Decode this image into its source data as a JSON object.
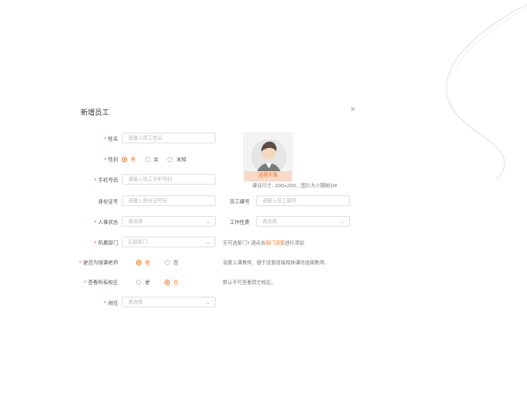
{
  "dialog": {
    "title": "新增员工",
    "close": "×"
  },
  "form": {
    "name": {
      "label": "姓名",
      "placeholder": "请输入员工姓名"
    },
    "gender": {
      "label": "性别",
      "options": [
        "男",
        "女",
        "未知"
      ],
      "selected": "男"
    },
    "phone": {
      "label": "手机号码",
      "placeholder": "请输入员工手机号码"
    },
    "id_card": {
      "label": "身份证号",
      "placeholder": "请输入身份证号码"
    },
    "employee_no": {
      "label": "员工编号",
      "placeholder": "请输入员工编号"
    },
    "hr_status": {
      "label": "人事状态",
      "value": "请选择"
    },
    "job_nature": {
      "label": "工作性质",
      "value": "请选择"
    },
    "department": {
      "label": "所属部门",
      "value": "后勤部门"
    },
    "department_hint": {
      "prefix": "无可选部门? 请点击",
      "link": "部门设置",
      "suffix": "进行添加"
    },
    "is_teacher": {
      "label": "是否为授课老师",
      "options": [
        "是",
        "否"
      ],
      "selected": "是"
    },
    "teacher_hint": "设置上课教师，便于设置班级和排课时选择教师。",
    "view_all": {
      "label": "查看所有校区",
      "options": [
        "是",
        "否"
      ],
      "selected": "否"
    },
    "view_all_hint": "默认不可查看其它校区。",
    "position": {
      "label": "岗位",
      "value": "请选择"
    }
  },
  "avatar": {
    "button": "选择头像",
    "hint": "建议尺寸: 200x200，图片大小限制1M"
  },
  "colors": {
    "accent": "#f07a2a",
    "required": "#e8542a"
  }
}
